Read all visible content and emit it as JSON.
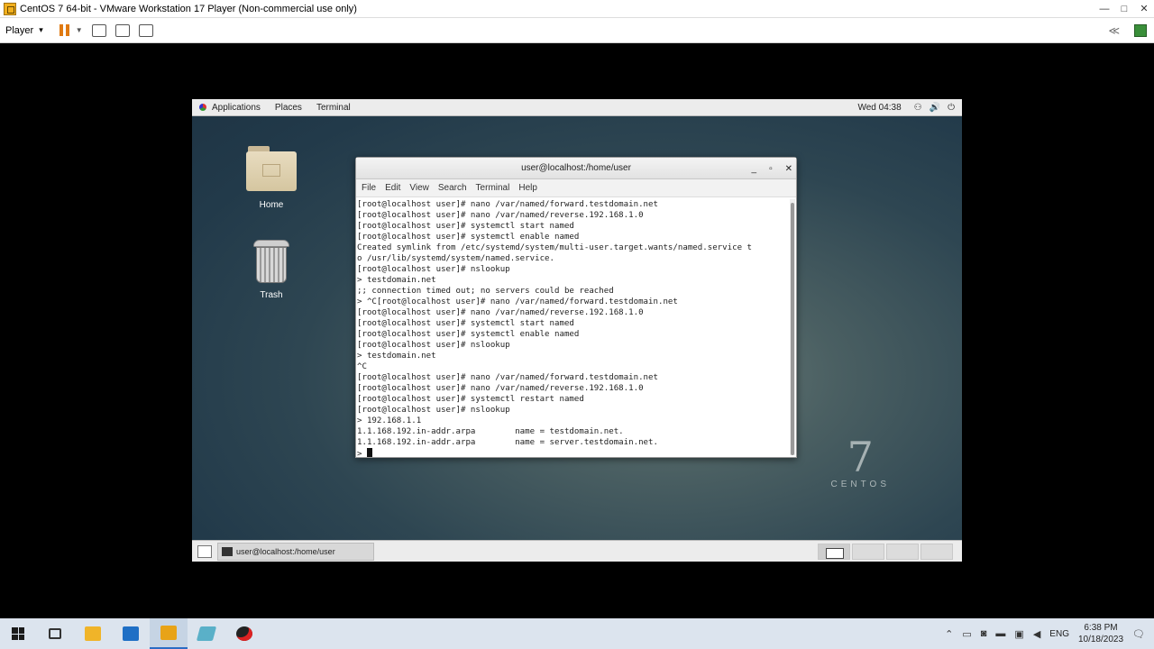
{
  "host": {
    "title": "CentOS 7 64-bit - VMware Workstation 17 Player (Non-commercial use only)",
    "window_controls": [
      "—",
      "□",
      "✕"
    ],
    "toolbar": {
      "player_label": "Player",
      "player_caret": "▾"
    },
    "toolbar_right": {
      "collapse": "≪"
    }
  },
  "guest": {
    "top_bar": {
      "applications": "Applications",
      "places": "Places",
      "terminal": "Terminal",
      "clock": "Wed 04:38",
      "network": "⚇",
      "volume": "🔊",
      "power": "⏻"
    },
    "desktop_icons": {
      "home": "Home",
      "trash": "Trash"
    },
    "logo": {
      "number": "7",
      "word": "CENTOS"
    },
    "terminal": {
      "title": "user@localhost:/home/user",
      "controls": [
        "_",
        "▫",
        "✕"
      ],
      "menu": [
        "File",
        "Edit",
        "View",
        "Search",
        "Terminal",
        "Help"
      ],
      "lines": [
        "[root@localhost user]# nano /var/named/forward.testdomain.net",
        "[root@localhost user]# nano /var/named/reverse.192.168.1.0",
        "[root@localhost user]# systemctl start named",
        "[root@localhost user]# systemctl enable named",
        "Created symlink from /etc/systemd/system/multi-user.target.wants/named.service t",
        "o /usr/lib/systemd/system/named.service.",
        "[root@localhost user]# nslookup",
        "> testdomain.net",
        ";; connection timed out; no servers could be reached",
        "> ^C[root@localhost user]# nano /var/named/forward.testdomain.net",
        "[root@localhost user]# nano /var/named/reverse.192.168.1.0",
        "[root@localhost user]# systemctl start named",
        "[root@localhost user]# systemctl enable named",
        "[root@localhost user]# nslookup",
        "> testdomain.net",
        "^C",
        "[root@localhost user]# nano /var/named/forward.testdomain.net",
        "[root@localhost user]# nano /var/named/reverse.192.168.1.0",
        "[root@localhost user]# systemctl restart named",
        "[root@localhost user]# nslookup",
        "> 192.168.1.1",
        "1.1.168.192.in-addr.arpa        name = testdomain.net.",
        "1.1.168.192.in-addr.arpa        name = server.testdomain.net."
      ],
      "prompt": "> "
    },
    "taskbar": {
      "task_label": "user@localhost:/home/user"
    }
  },
  "windows_taskbar": {
    "tray": {
      "chevron": "⌃",
      "lang": "ENG",
      "time": "6:38 PM",
      "date": "10/18/2023",
      "notifications": "🗨"
    },
    "apps": [
      {
        "name": "task-view",
        "color": "#3a3a3a"
      },
      {
        "name": "file-explorer",
        "color": "#f0b429"
      },
      {
        "name": "mail",
        "color": "#1f6fc5"
      },
      {
        "name": "vmware",
        "color": "#e8a317"
      },
      {
        "name": "notepad",
        "color": "#5ab0c8"
      },
      {
        "name": "recorder",
        "color": "#222222"
      }
    ]
  }
}
